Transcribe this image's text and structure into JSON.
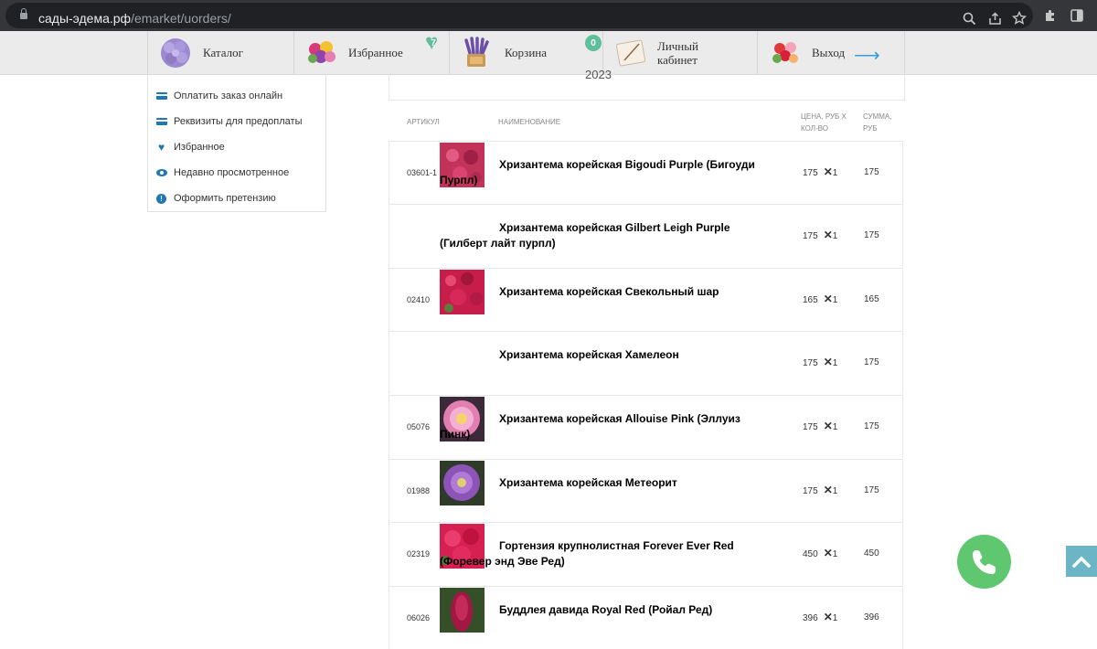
{
  "browser": {
    "url_host": "сады-эдема.рф",
    "url_path": "/emarket/uorders/"
  },
  "nav": {
    "items": [
      {
        "label": "Каталог",
        "icon": "hydrangea-icon"
      },
      {
        "label": "Избранное",
        "icon": "bouquet-icon",
        "badge": "7"
      },
      {
        "label": "Корзина",
        "icon": "basket-icon",
        "badge": "0"
      },
      {
        "label_line1": "Личный",
        "label_line2": "кабинет",
        "icon": "notebook-icon"
      },
      {
        "label": "Выход",
        "icon": "flowers-icon"
      }
    ]
  },
  "sidebar": {
    "items": [
      {
        "label": "Оплатить заказ онлайн",
        "icon": "card-icon"
      },
      {
        "label": "Реквизиты для предоплаты",
        "icon": "card-icon"
      },
      {
        "label": "Избранное",
        "icon": "heart-icon"
      },
      {
        "label": "Недавно просмотренное",
        "icon": "eye-icon"
      },
      {
        "label": "Оформить претензию",
        "icon": "info-icon"
      }
    ]
  },
  "order": {
    "year": "2023"
  },
  "table": {
    "headers": {
      "sku": "АРТИКУЛ",
      "name": "НАИМЕНОВАНИЕ",
      "price_line1": "ЦЕНА, РУБ Х",
      "price_line2": "КОЛ-ВО",
      "sum_line1": "СУММА,",
      "sum_line2": "РУБ"
    },
    "rows": [
      {
        "sku": "03601-1",
        "name": "Хризантема корейская Bigoudi Purple (Бигоуди Пурпл)",
        "price": "175",
        "qty": "1",
        "sum": "175",
        "thumb_color": "#c2335a",
        "has_thumb": true
      },
      {
        "sku": "",
        "name": "Хризантема корейская Gilbert Leigh Purple (Гилберт лайт пурпл)",
        "price": "175",
        "qty": "1",
        "sum": "175",
        "has_thumb": false
      },
      {
        "sku": "02410",
        "name": "Хризантема корейская Свекольный шар",
        "price": "165",
        "qty": "1",
        "sum": "165",
        "thumb_color": "#c71d4a",
        "has_thumb": true
      },
      {
        "sku": "",
        "name": "Хризантема корейская Хамелеон",
        "price": "175",
        "qty": "1",
        "sum": "175",
        "has_thumb": false
      },
      {
        "sku": "05076",
        "name": "Хризантема корейская Allouise Pink (Эллуиз Пинк)",
        "price": "175",
        "qty": "1",
        "sum": "175",
        "thumb_color": "#e27fb1",
        "has_thumb": true
      },
      {
        "sku": "01988",
        "name": "Хризантема корейская Метеорит",
        "price": "175",
        "qty": "1",
        "sum": "175",
        "thumb_color": "#8d54b8",
        "has_thumb": true
      },
      {
        "sku": "02319",
        "name": "Гортензия крупнолистная Forever Ever Red (Форевер энд Эве Ред)",
        "price": "450",
        "qty": "1",
        "sum": "450",
        "thumb_color": "#d62052",
        "has_thumb": true
      },
      {
        "sku": "06026",
        "name": "Буддлея давида Royal Red (Ройал Ред)",
        "price": "396",
        "qty": "1",
        "sum": "396",
        "thumb_color": "#a01843",
        "has_thumb": true
      }
    ]
  },
  "colors": {
    "accent_blue": "#1f78b4",
    "badge_green": "#5fbf9a",
    "call_green": "#5ec770",
    "scroll_teal": "#6bb5c7"
  }
}
